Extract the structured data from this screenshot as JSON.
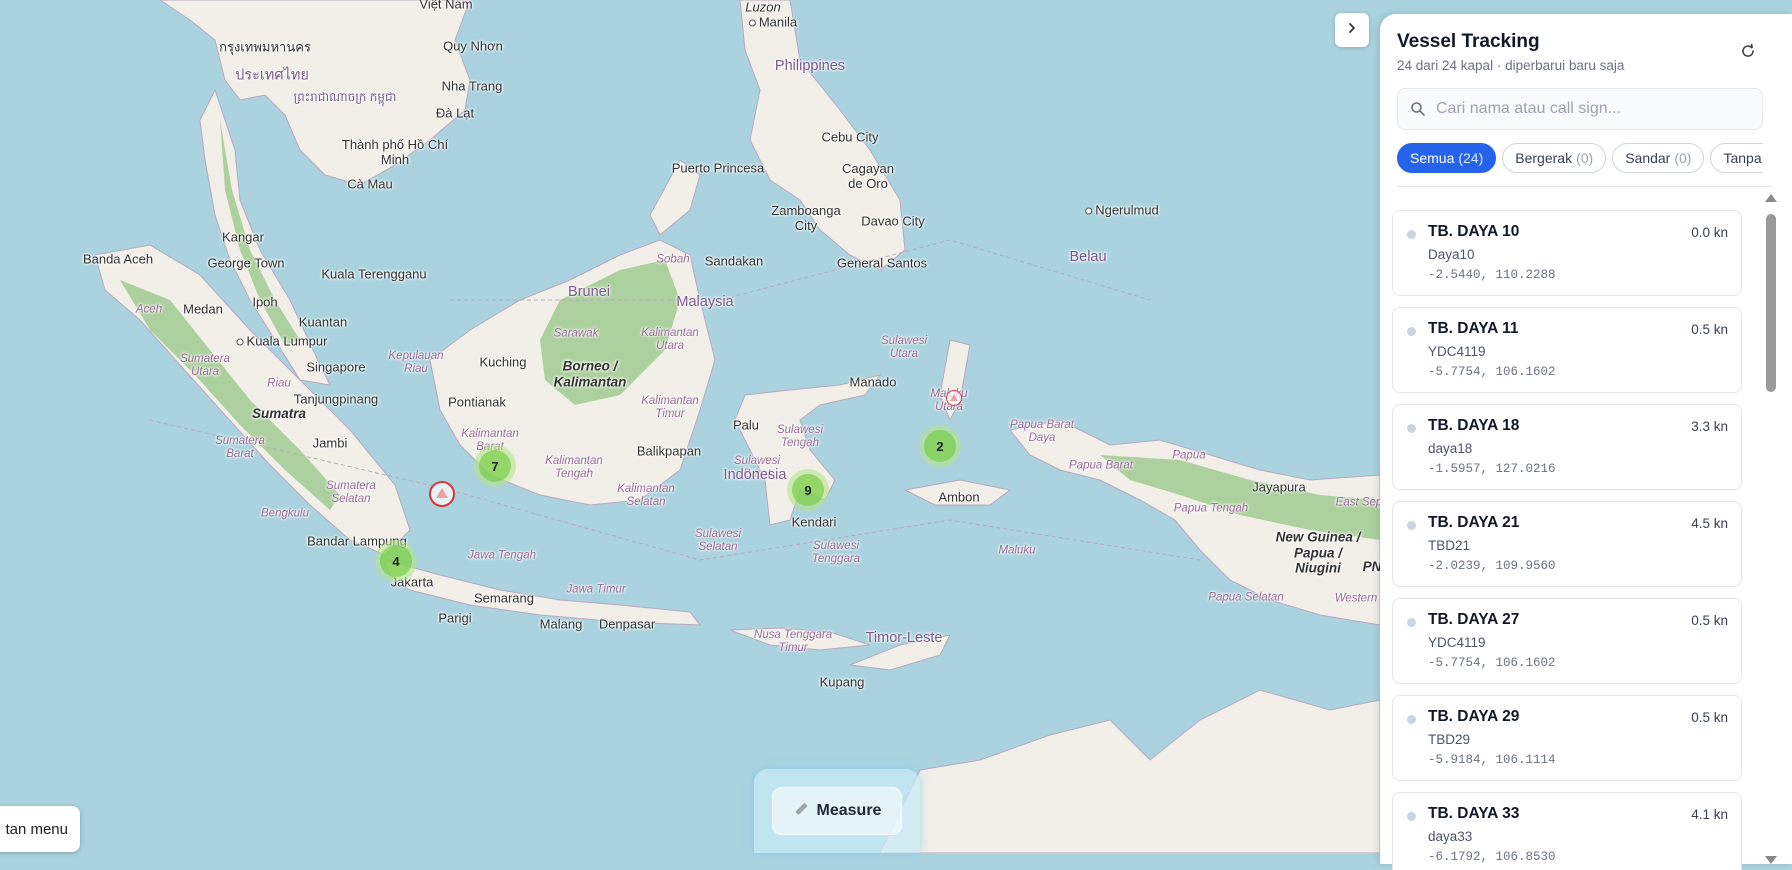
{
  "map": {
    "labels": {
      "viet_nam": "Việt Nam",
      "luzon": "Luzon",
      "manila": "Manila",
      "bangkok": "กรุงเทพมหานคร",
      "thailand": "ประเทศไทย",
      "quy_nhon": "Quy Nhơn",
      "cambodia": "ព្រះរាជាណាចក្រ កម្ពុជា",
      "nha_trang": "Nha Trang",
      "da_lat": "Đà Lạt",
      "hcm": "Thành phố Hồ Chí Minh",
      "ca_mau": "Cà Mau",
      "philippines": "Philippines",
      "puerto_princesa": "Puerto Princesa",
      "cebu": "Cebu City",
      "cagayan": "Cagayan de Oro",
      "zamboanga": "Zamboanga City",
      "davao": "Davao City",
      "general_santos": "General Santos",
      "ngerulmud": "Ngerulmud",
      "belau": "Belau",
      "kangar": "Kangar",
      "george_town": "George Town",
      "banda_aceh": "Banda Aceh",
      "kuala_terengganu": "Kuala Terengganu",
      "ipoh": "Ipoh",
      "kuantan": "Kuantan",
      "medan": "Medan",
      "aceh": "Aceh",
      "kuala_lumpur": "Kuala Lumpur",
      "singapore": "Singapore",
      "sumatera_utara": "Sumatera Utara",
      "riau": "Riau",
      "kepulauan_riau": "Kepulauan Riau",
      "tanjungpinang": "Tanjungpinang",
      "sumatra": "Sumatra",
      "sumatera_barat": "Sumatera Barat",
      "jambi": "Jambi",
      "sumatera_selatan": "Sumatera Selatan",
      "bengkulu": "Bengkulu",
      "bandar_lampung": "Bandar Lampung",
      "jakarta": "Jakarta",
      "jawa_tengah": "Jawa Tengah",
      "jawa_timur": "Jawa Timur",
      "semarang": "Semarang",
      "parigi": "Parigi",
      "malang": "Malang",
      "denpasar": "Denpasar",
      "brunei": "Brunei",
      "sobah": "Sobah",
      "sandakan": "Sandakan",
      "malaysia": "Malaysia",
      "sarawak": "Sarawak",
      "kuching": "Kuching",
      "borneo": "Borneo / Kalimantan",
      "kalimantan_utara": "Kalimantan Utara",
      "pontianak": "Pontianak",
      "kalimantan_barat": "Kalimantan Barat",
      "kalimantan_timur": "Kalimantan Timur",
      "kalimantan_tengah": "Kalimantan Tengah",
      "kalimantan_selatan": "Kalimantan Selatan",
      "balikpapan": "Balikpapan",
      "palu": "Palu",
      "sulawesi_tengah": "Sulawesi Tengah",
      "sulawesi_barat": "Sulawesi Barat",
      "indonesia": "Indonesia",
      "sulawesi_selatan": "Sulawesi Selatan",
      "kendari": "Kendari",
      "sulawesi_tenggara": "Sulawesi Tenggara",
      "manado": "Manado",
      "sulawesi_utara": "Sulawesi Utara",
      "maluku_utara": "Maluku Utara",
      "ambon": "Ambon",
      "maluku": "Maluku",
      "papua_barat_daya": "Papua Barat Daya",
      "papua_barat": "Papua Barat",
      "papua": "Papua",
      "jayapura": "Jayapura",
      "east_sepik": "East Sep",
      "papua_tengah": "Papua Tengah",
      "new_guinea": "New Guinea / Papua / Niugini",
      "png_abbr": "PN",
      "papua_selatan": "Papua Selatan",
      "western": "Western",
      "nusa_tenggara_timur": "Nusa Tenggara Timur",
      "timor_leste": "Timor-Leste",
      "kupang": "Kupang"
    },
    "clusters": [
      {
        "label": "7"
      },
      {
        "label": "9"
      },
      {
        "label": "2"
      },
      {
        "label": "4"
      }
    ],
    "colors": {
      "sea": "#aad3df",
      "land": "#f2efe9",
      "forest": "#add19e",
      "cluster": "#6ecc39",
      "marker": "#d9363e"
    }
  },
  "menu_button": {
    "label": "tan menu"
  },
  "measure_button": {
    "label": "Measure",
    "icon": "ruler-icon"
  },
  "toggle_button": {
    "icon": "chevron-right-icon"
  },
  "panel": {
    "title": "Vessel Tracking",
    "subtitle": "24 dari 24 kapal · diperbarui baru saja",
    "refresh_icon": "refresh-icon",
    "search": {
      "placeholder": "Cari nama atau call sign...",
      "value": ""
    },
    "filters": [
      {
        "label": "Semua",
        "count": "(24)"
      },
      {
        "label": "Bergerak",
        "count": "(0)"
      },
      {
        "label": "Sandar",
        "count": "(0)"
      },
      {
        "label": "Tanpa",
        "count": ""
      }
    ],
    "vessels": [
      {
        "name": "TB. DAYA 10",
        "speed": "0.0 kn",
        "call_sign": "Daya10",
        "coords": "-2.5440, 110.2288"
      },
      {
        "name": "TB. DAYA 11",
        "speed": "0.5 kn",
        "call_sign": "YDC4119",
        "coords": "-5.7754, 106.1602"
      },
      {
        "name": "TB. DAYA 18",
        "speed": "3.3 kn",
        "call_sign": "daya18",
        "coords": "-1.5957, 127.0216"
      },
      {
        "name": "TB. DAYA 21",
        "speed": "4.5 kn",
        "call_sign": "TBD21",
        "coords": "-2.0239, 109.9560"
      },
      {
        "name": "TB. DAYA 27",
        "speed": "0.5 kn",
        "call_sign": "YDC4119",
        "coords": "-5.7754, 106.1602"
      },
      {
        "name": "TB. DAYA 29",
        "speed": "0.5 kn",
        "call_sign": "TBD29",
        "coords": "-5.9184, 106.1114"
      },
      {
        "name": "TB. DAYA 33",
        "speed": "4.1 kn",
        "call_sign": "daya33",
        "coords": "-6.1792, 106.8530"
      }
    ]
  }
}
